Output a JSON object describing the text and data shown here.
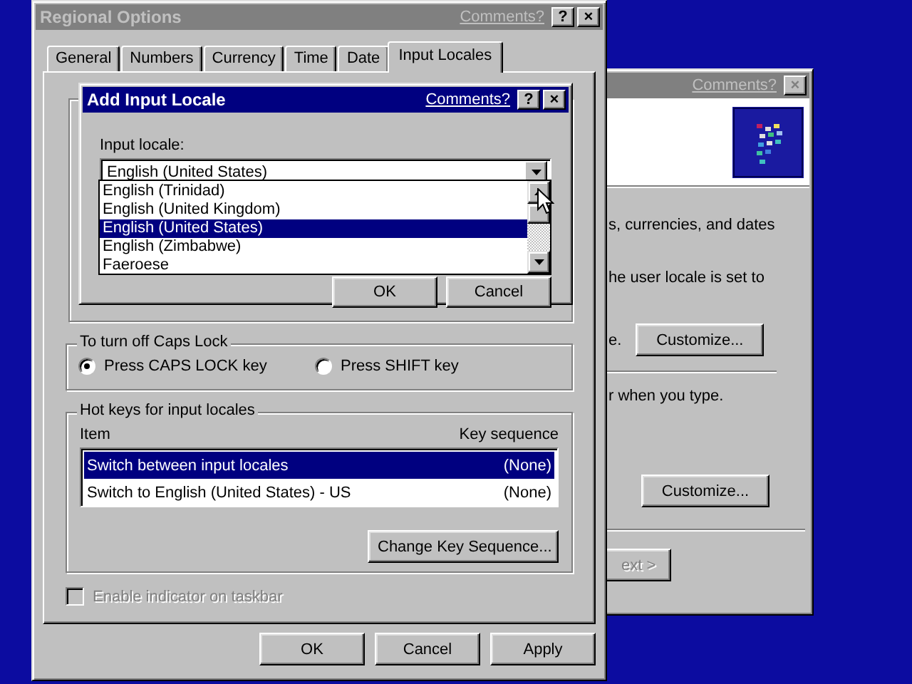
{
  "back_window": {
    "comments_link": "Comments?",
    "close_button": "×",
    "lines": [
      "s, currencies, and dates",
      "he user locale is set to"
    ],
    "customize_note": "e.",
    "customize_button_1": "Customize...",
    "input_line": "r when you type.",
    "customize_button_2": "Customize...",
    "next_button": "ext >"
  },
  "main_window": {
    "title": "Regional Options",
    "comments_link": "Comments?",
    "help_button": "?",
    "close_button": "×",
    "tabs": [
      {
        "label": "General",
        "selected": false
      },
      {
        "label": "Numbers",
        "selected": false
      },
      {
        "label": "Currency",
        "selected": false
      },
      {
        "label": "Time",
        "selected": false
      },
      {
        "label": "Date",
        "selected": false
      },
      {
        "label": "Input Locales",
        "selected": true
      }
    ],
    "caps_lock": {
      "title": "To turn off Caps Lock",
      "options": [
        {
          "label": "Press CAPS LOCK key",
          "selected": true
        },
        {
          "label": "Press SHIFT key",
          "selected": false
        }
      ]
    },
    "hotkeys": {
      "title": "Hot keys for input locales",
      "columns": [
        "Item",
        "Key sequence"
      ],
      "rows": [
        {
          "item": "Switch between input locales",
          "key": "(None)",
          "selected": true
        },
        {
          "item": "Switch to English (United States) - US",
          "key": "(None)",
          "selected": false
        }
      ],
      "button": "Change Key Sequence..."
    },
    "indicator": {
      "label": "Enable indicator on taskbar",
      "checked": false,
      "disabled": true
    },
    "buttons": [
      "OK",
      "Cancel",
      "Apply"
    ]
  },
  "dialog": {
    "title": "Add Input Locale",
    "comments_link": "Comments?",
    "help_button": "?",
    "close_button": "×",
    "field_label": "Input locale:",
    "value": "English (United States)",
    "options": [
      {
        "label": "English (Trinidad)",
        "selected": false
      },
      {
        "label": "English (United Kingdom)",
        "selected": false
      },
      {
        "label": "English (United States)",
        "selected": true
      },
      {
        "label": "English (Zimbabwe)",
        "selected": false
      },
      {
        "label": "Faeroese",
        "selected": false
      }
    ],
    "buttons": [
      "OK",
      "Cancel"
    ]
  }
}
